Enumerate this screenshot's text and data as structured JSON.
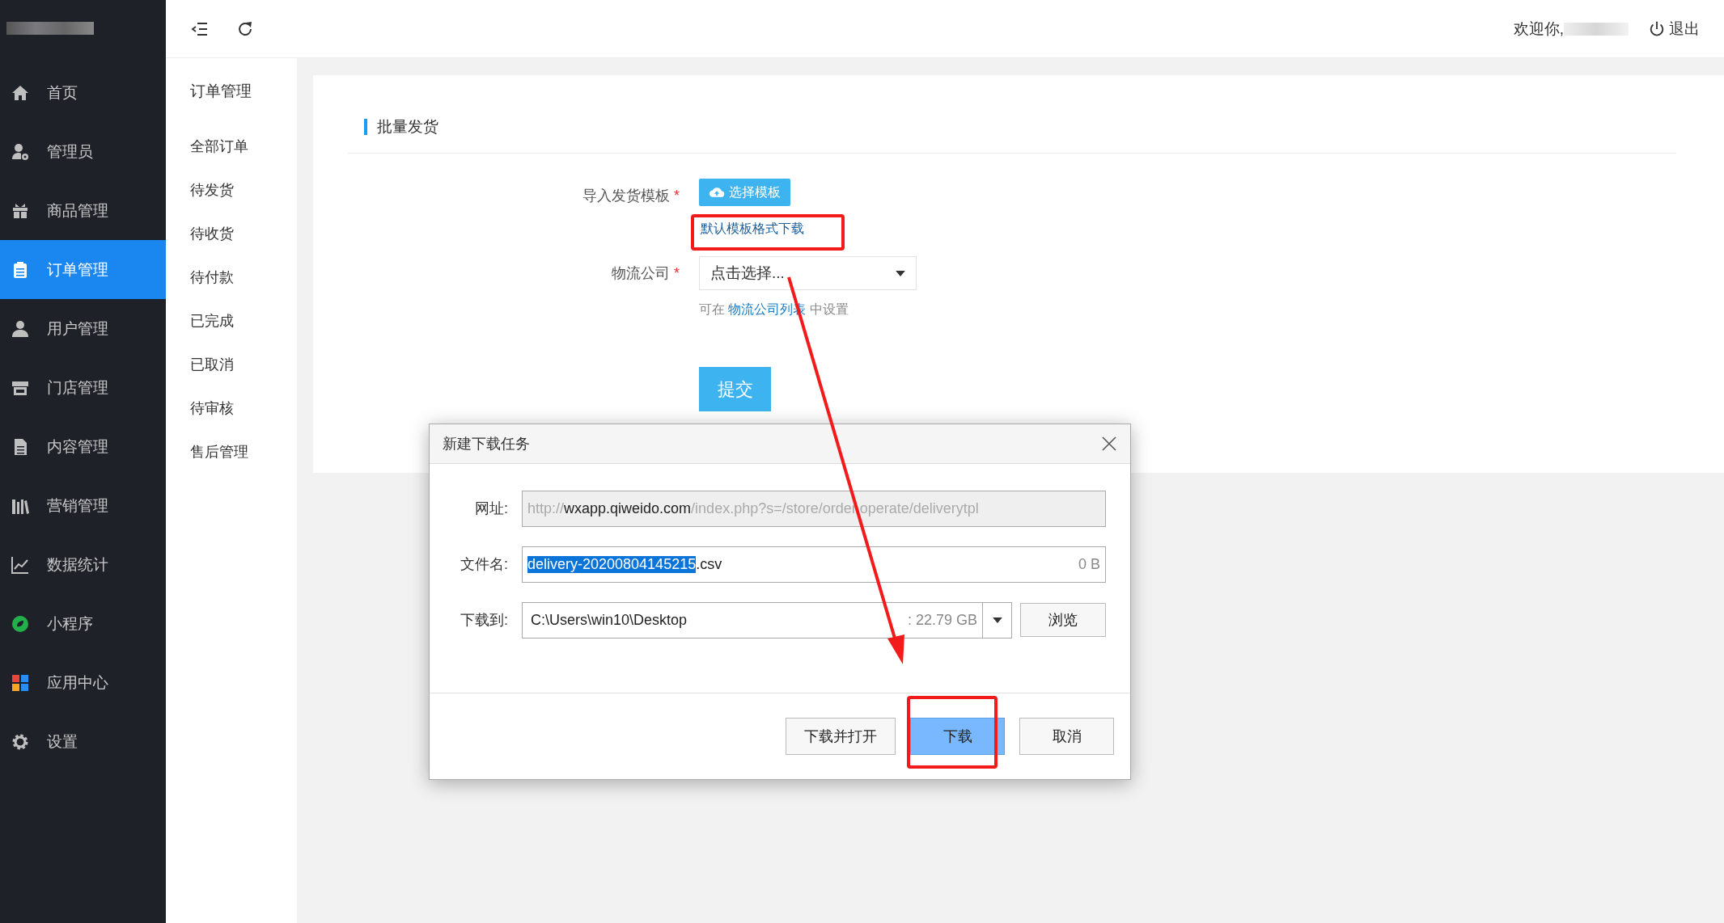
{
  "topbar": {
    "welcome": "欢迎你,",
    "logout": "退出"
  },
  "sidebar": {
    "items": [
      {
        "label": "首页",
        "selected": false
      },
      {
        "label": "管理员",
        "selected": false
      },
      {
        "label": "商品管理",
        "selected": false
      },
      {
        "label": "订单管理",
        "selected": true
      },
      {
        "label": "用户管理",
        "selected": false
      },
      {
        "label": "门店管理",
        "selected": false
      },
      {
        "label": "内容管理",
        "selected": false
      },
      {
        "label": "营销管理",
        "selected": false
      },
      {
        "label": "数据统计",
        "selected": false
      },
      {
        "label": "小程序",
        "selected": false
      },
      {
        "label": "应用中心",
        "selected": false
      },
      {
        "label": "设置",
        "selected": false
      }
    ]
  },
  "submenu": {
    "title": "订单管理",
    "items": [
      "全部订单",
      "待发货",
      "待收货",
      "待付款",
      "已完成",
      "已取消",
      "待审核",
      "售后管理"
    ]
  },
  "form": {
    "title": "批量发货",
    "fields": [
      {
        "kind": "upload",
        "label": "导入发货模板",
        "required_mark": "*",
        "button": "选择模板",
        "link": "默认模板格式下载"
      },
      {
        "kind": "select",
        "label": "物流公司",
        "required_mark": "*",
        "placeholder": "点击选择...",
        "hint_before": "可在",
        "hint_link": "物流公司列表",
        "hint_after": "中设置"
      }
    ],
    "submit": "提交"
  },
  "dialog": {
    "title": "新建下载任务",
    "rows": [
      {
        "kind": "url",
        "label": "网址:",
        "scheme": "http://",
        "host": "wxapp.qiweido.com",
        "path": "/index.php?s=/store/order.operate/deliverytpl"
      },
      {
        "kind": "filename",
        "label": "文件名:",
        "selected_text": "delivery-20200804145215",
        "rest": ".csv",
        "size": "0 B"
      },
      {
        "kind": "folder",
        "label": "下载到:",
        "value": "C:\\Users\\win10\\Desktop",
        "free_space": ": 22.79 GB",
        "button": "浏览"
      }
    ],
    "buttons": [
      {
        "label": "下载并打开",
        "selected": false
      },
      {
        "label": "下载",
        "selected": true
      },
      {
        "label": "取消",
        "selected": false
      }
    ]
  }
}
